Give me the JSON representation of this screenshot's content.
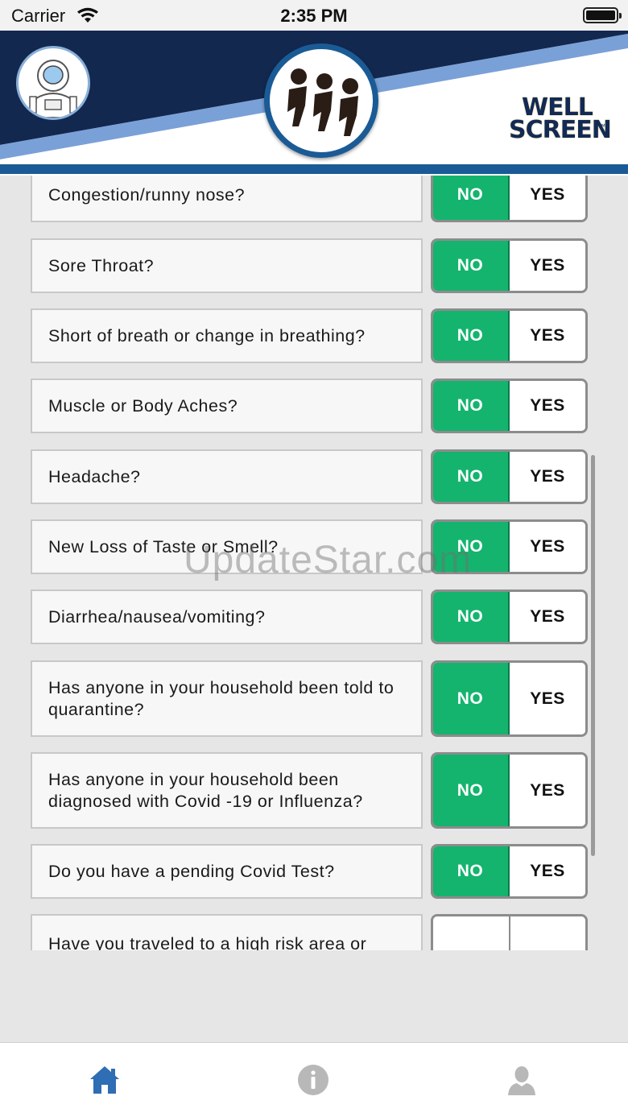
{
  "status_bar": {
    "carrier": "Carrier",
    "time": "2:35 PM"
  },
  "header": {
    "brand_line1": "WELL",
    "brand_line2": "SCREEN",
    "brand_tm": "™",
    "colors": {
      "navy": "#13284f",
      "stripe": "#7aa0d8",
      "accent": "#1a5b96"
    }
  },
  "questions": [
    {
      "text": "Congestion/runny nose?",
      "no": "NO",
      "yes": "YES",
      "selected": "NO"
    },
    {
      "text": "Sore Throat?",
      "no": "NO",
      "yes": "YES",
      "selected": "NO"
    },
    {
      "text": "Short of breath or change in breathing?",
      "no": "NO",
      "yes": "YES",
      "selected": "NO"
    },
    {
      "text": "Muscle or Body Aches?",
      "no": "NO",
      "yes": "YES",
      "selected": "NO"
    },
    {
      "text": "Headache?",
      "no": "NO",
      "yes": "YES",
      "selected": "NO"
    },
    {
      "text": "New Loss of Taste or Smell?",
      "no": "NO",
      "yes": "YES",
      "selected": "NO"
    },
    {
      "text": "Diarrhea/nausea/vomiting?",
      "no": "NO",
      "yes": "YES",
      "selected": "NO"
    },
    {
      "text": "Has anyone in your household been told to quarantine?",
      "no": "NO",
      "yes": "YES",
      "selected": "NO"
    },
    {
      "text": "Has anyone in your household been diagnosed with Covid -19 or Influenza?",
      "no": "NO",
      "yes": "YES",
      "selected": "NO"
    },
    {
      "text": "Do you have a pending Covid Test?",
      "no": "NO",
      "yes": "YES",
      "selected": "NO"
    },
    {
      "text": "Have you traveled to a high risk area or",
      "no": "",
      "yes": "",
      "selected": ""
    }
  ],
  "watermark": "UpdateStar.com",
  "tab_bar": {
    "tabs": [
      {
        "icon": "home-icon",
        "active": true,
        "color": "#2f6db5"
      },
      {
        "icon": "info-icon",
        "active": false,
        "color": "#b8b8b8"
      },
      {
        "icon": "profile-icon",
        "active": false,
        "color": "#b8b8b8"
      }
    ]
  },
  "colors": {
    "no_selected": "#14b46e",
    "background": "#e6e6e6"
  }
}
